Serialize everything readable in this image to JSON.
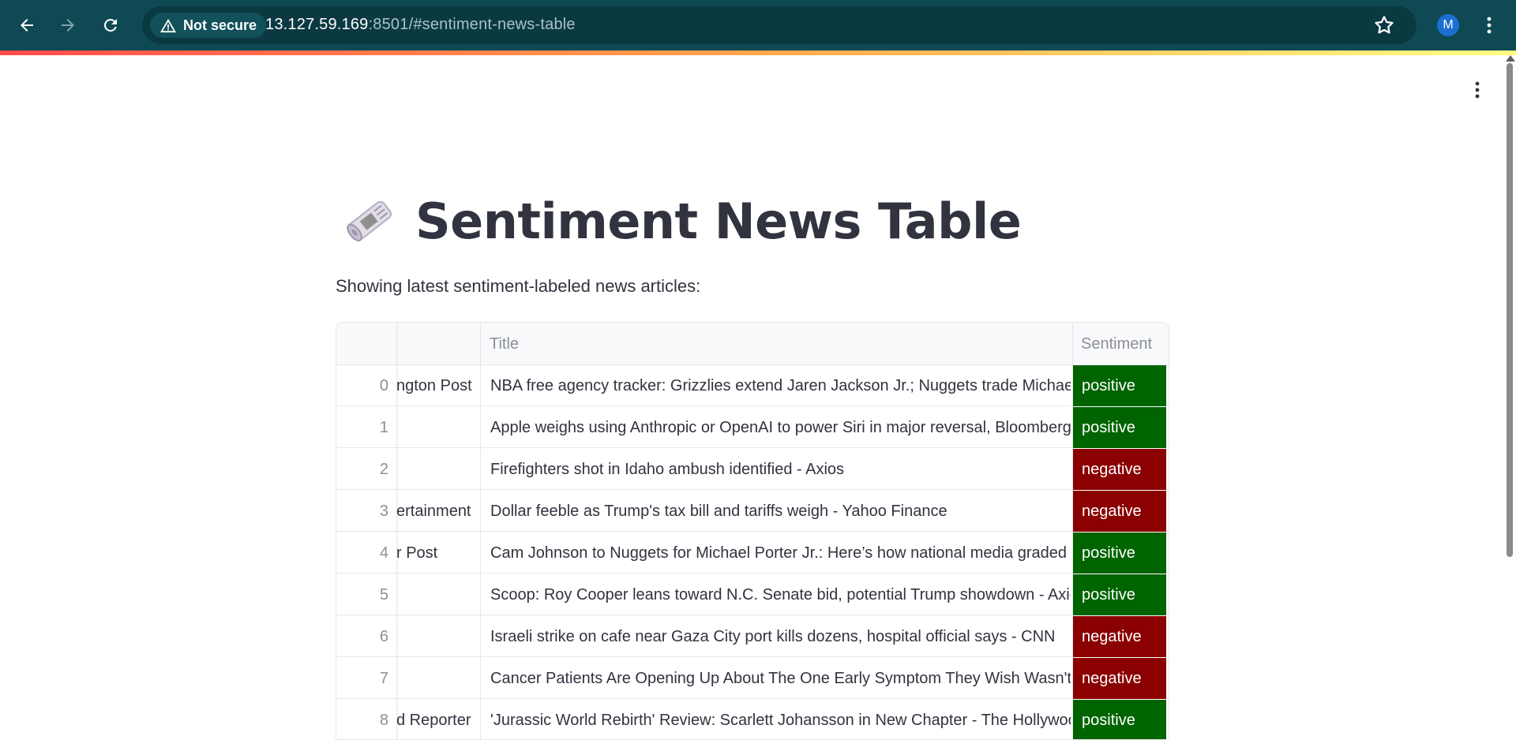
{
  "browser": {
    "security_label": "Not secure",
    "url_host": "13.127.59.169",
    "url_rest": ":8501/#sentiment-news-table",
    "avatar_initial": "M"
  },
  "page": {
    "title": "Sentiment News Table",
    "title_icon": "newspaper-roll-icon",
    "subtitle": "Showing latest sentiment-labeled news articles:"
  },
  "table": {
    "columns": [
      "",
      "",
      "Title",
      "Sentiment"
    ],
    "rows": [
      {
        "index": "0",
        "source": "ngton Post",
        "title": "NBA free agency tracker: Grizzlies extend Jaren Jackson Jr.; Nuggets trade Michael Po",
        "sentiment": "positive"
      },
      {
        "index": "1",
        "source": "",
        "title": "Apple weighs using Anthropic or OpenAI to power Siri in major reversal, Bloomberg N",
        "sentiment": "positive"
      },
      {
        "index": "2",
        "source": "",
        "title": "Firefighters shot in Idaho ambush identified - Axios",
        "sentiment": "negative"
      },
      {
        "index": "3",
        "source": "ertainment",
        "title": "Dollar feeble as Trump's tax bill and tariffs weigh - Yahoo Finance",
        "sentiment": "negative"
      },
      {
        "index": "4",
        "source": "r Post",
        "title": "Cam Johnson to Nuggets for Michael Porter Jr.: Here’s how national media graded the",
        "sentiment": "positive"
      },
      {
        "index": "5",
        "source": "",
        "title": "Scoop: Roy Cooper leans toward N.C. Senate bid, potential Trump showdown - Axios",
        "sentiment": "positive"
      },
      {
        "index": "6",
        "source": "",
        "title": "Israeli strike on cafe near Gaza City port kills dozens, hospital official says - CNN",
        "sentiment": "negative"
      },
      {
        "index": "7",
        "source": "",
        "title": "Cancer Patients Are Opening Up About The One Early Symptom They Wish Wasn't Ign",
        "sentiment": "negative"
      },
      {
        "index": "8",
        "source": "d Reporter",
        "title": "'Jurassic World Rebirth' Review: Scarlett Johansson in New Chapter - The Hollywood",
        "sentiment": "positive"
      }
    ]
  },
  "colors": {
    "chrome_bg": "#0f4a54",
    "positive": "#006400",
    "negative": "#8b0000",
    "text": "#31333f"
  }
}
